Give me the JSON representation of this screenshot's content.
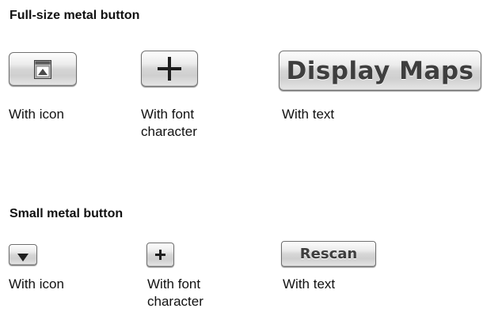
{
  "sections": {
    "full": {
      "title": "Full-size metal button",
      "buttons": {
        "icon": {
          "icon": "window-tray-icon",
          "caption": "With icon"
        },
        "font": {
          "icon": "plus-icon",
          "caption": "With font\ncharacter"
        },
        "text": {
          "label": "Display Maps",
          "caption": "With text"
        }
      }
    },
    "small": {
      "title": "Small metal button",
      "buttons": {
        "icon": {
          "icon": "triangle-down-icon",
          "caption": "With icon"
        },
        "font": {
          "icon": "plus-icon",
          "caption": "With font\ncharacter"
        },
        "text": {
          "label": "Rescan",
          "caption": "With text"
        }
      }
    }
  },
  "colors": {
    "button_border": "#6f6f6f",
    "button_text": "#3e3e3e",
    "glyph": "#1e1e1e"
  }
}
